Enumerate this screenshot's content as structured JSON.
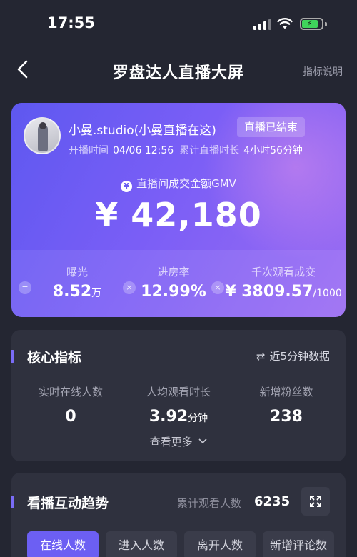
{
  "status": {
    "time": "17:55"
  },
  "nav": {
    "title": "罗盘达人直播大屏",
    "help": "指标说明"
  },
  "anchor": {
    "name": "小曼.studio(小曼直播在这)",
    "badge": "直播已结束",
    "start_label": "开播时间",
    "start_value": "04/06 12:56",
    "duration_label": "累计直播时长",
    "duration_value": "4小时56分钟"
  },
  "gmv": {
    "label": "直播间成交金额GMV",
    "coin": "¥",
    "value": "¥ 42,180"
  },
  "hero_metrics": [
    {
      "label": "曝光",
      "value": "8.52",
      "unit": "万"
    },
    {
      "label": "进房率",
      "value": "12.99%",
      "unit": ""
    },
    {
      "label": "千次观看成交",
      "value": "¥ 3809.57",
      "unit": "/1000"
    }
  ],
  "operators": {
    "eq": "=",
    "times1": "×",
    "times2": "×"
  },
  "core": {
    "title": "核心指标",
    "refresh_label": "近5分钟数据",
    "metrics": [
      {
        "label": "实时在线人数",
        "value": "0",
        "unit": ""
      },
      {
        "label": "人均观看时长",
        "value": "3.92",
        "unit": "分钟"
      },
      {
        "label": "新增粉丝数",
        "value": "238",
        "unit": ""
      }
    ],
    "more": "查看更多"
  },
  "trend": {
    "title": "看播互动趋势",
    "total_label": "累计观看人数",
    "total_value": "6235",
    "tabs": [
      "在线人数",
      "进入人数",
      "离开人数",
      "新增评论数"
    ],
    "active_tab": "在线人数"
  },
  "colors": {
    "accent": "#6c5ff3",
    "background": "#242632",
    "card": "#2f313e"
  }
}
